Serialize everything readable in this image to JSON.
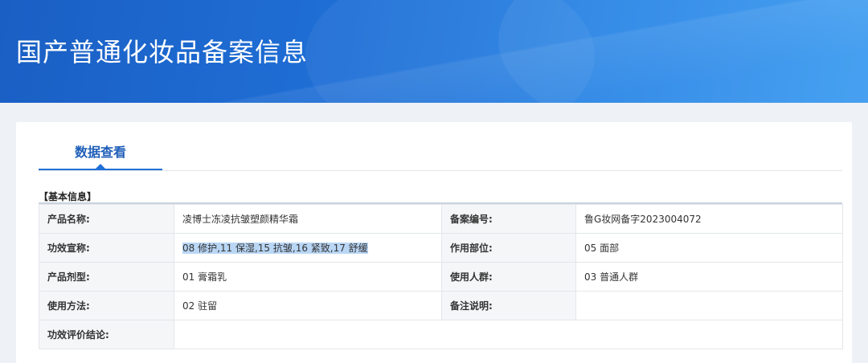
{
  "header": {
    "title": "国产普通化妆品备案信息"
  },
  "tabs": [
    {
      "label": "数据查看",
      "active": true
    }
  ],
  "section": {
    "title": "【基本信息】"
  },
  "rows": [
    {
      "label1": "产品名称:",
      "value1": "凌博士冻凌抗皱塑颜精华霜",
      "label2": "备案编号:",
      "value2": "鲁G妆网备字2023004072"
    },
    {
      "label1": "功效宣称:",
      "value1": "08 修护,11 保湿,15 抗皱,16 紧致,17 舒缓",
      "label2": "作用部位:",
      "value2": "05 面部"
    },
    {
      "label1": "产品剂型:",
      "value1": "01 膏霜乳",
      "label2": "使用人群:",
      "value2": "03 普通人群"
    },
    {
      "label1": "使用方法:",
      "value1": "02 驻留",
      "label2": "备注说明:",
      "value2": ""
    },
    {
      "label1": "功效评价结论:",
      "value1": ""
    }
  ],
  "colors": {
    "banner": "#1f6fd6",
    "accent": "#1f5fb8",
    "highlight": "#b9d6f5"
  }
}
